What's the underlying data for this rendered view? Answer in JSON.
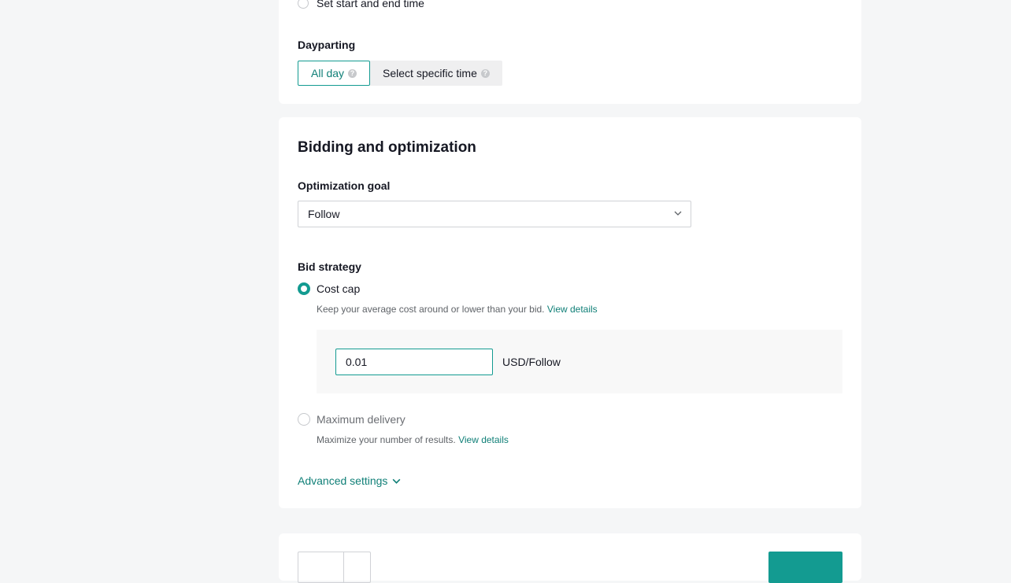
{
  "schedule": {
    "set_time_option": "Set start and end time",
    "dayparting_label": "Dayparting",
    "dayparting_all_day": "All day",
    "dayparting_specific": "Select specific time",
    "help_glyph": "?"
  },
  "bidding": {
    "title": "Bidding and optimization",
    "optimization_goal_label": "Optimization goal",
    "optimization_goal_value": "Follow",
    "bid_strategy_label": "Bid strategy",
    "cost_cap": {
      "label": "Cost cap",
      "description": "Keep your average cost around or lower than your bid.",
      "link": "View details",
      "selected": true
    },
    "bid_value": "0.01",
    "bid_unit": "USD/Follow",
    "max_delivery": {
      "label": "Maximum delivery",
      "description": "Maximize your number of results.",
      "link": "View details",
      "selected": false
    },
    "advanced_settings": "Advanced settings"
  },
  "colors": {
    "accent": "#139b91",
    "link": "#0f7f77",
    "background": "#f5f6f7"
  }
}
